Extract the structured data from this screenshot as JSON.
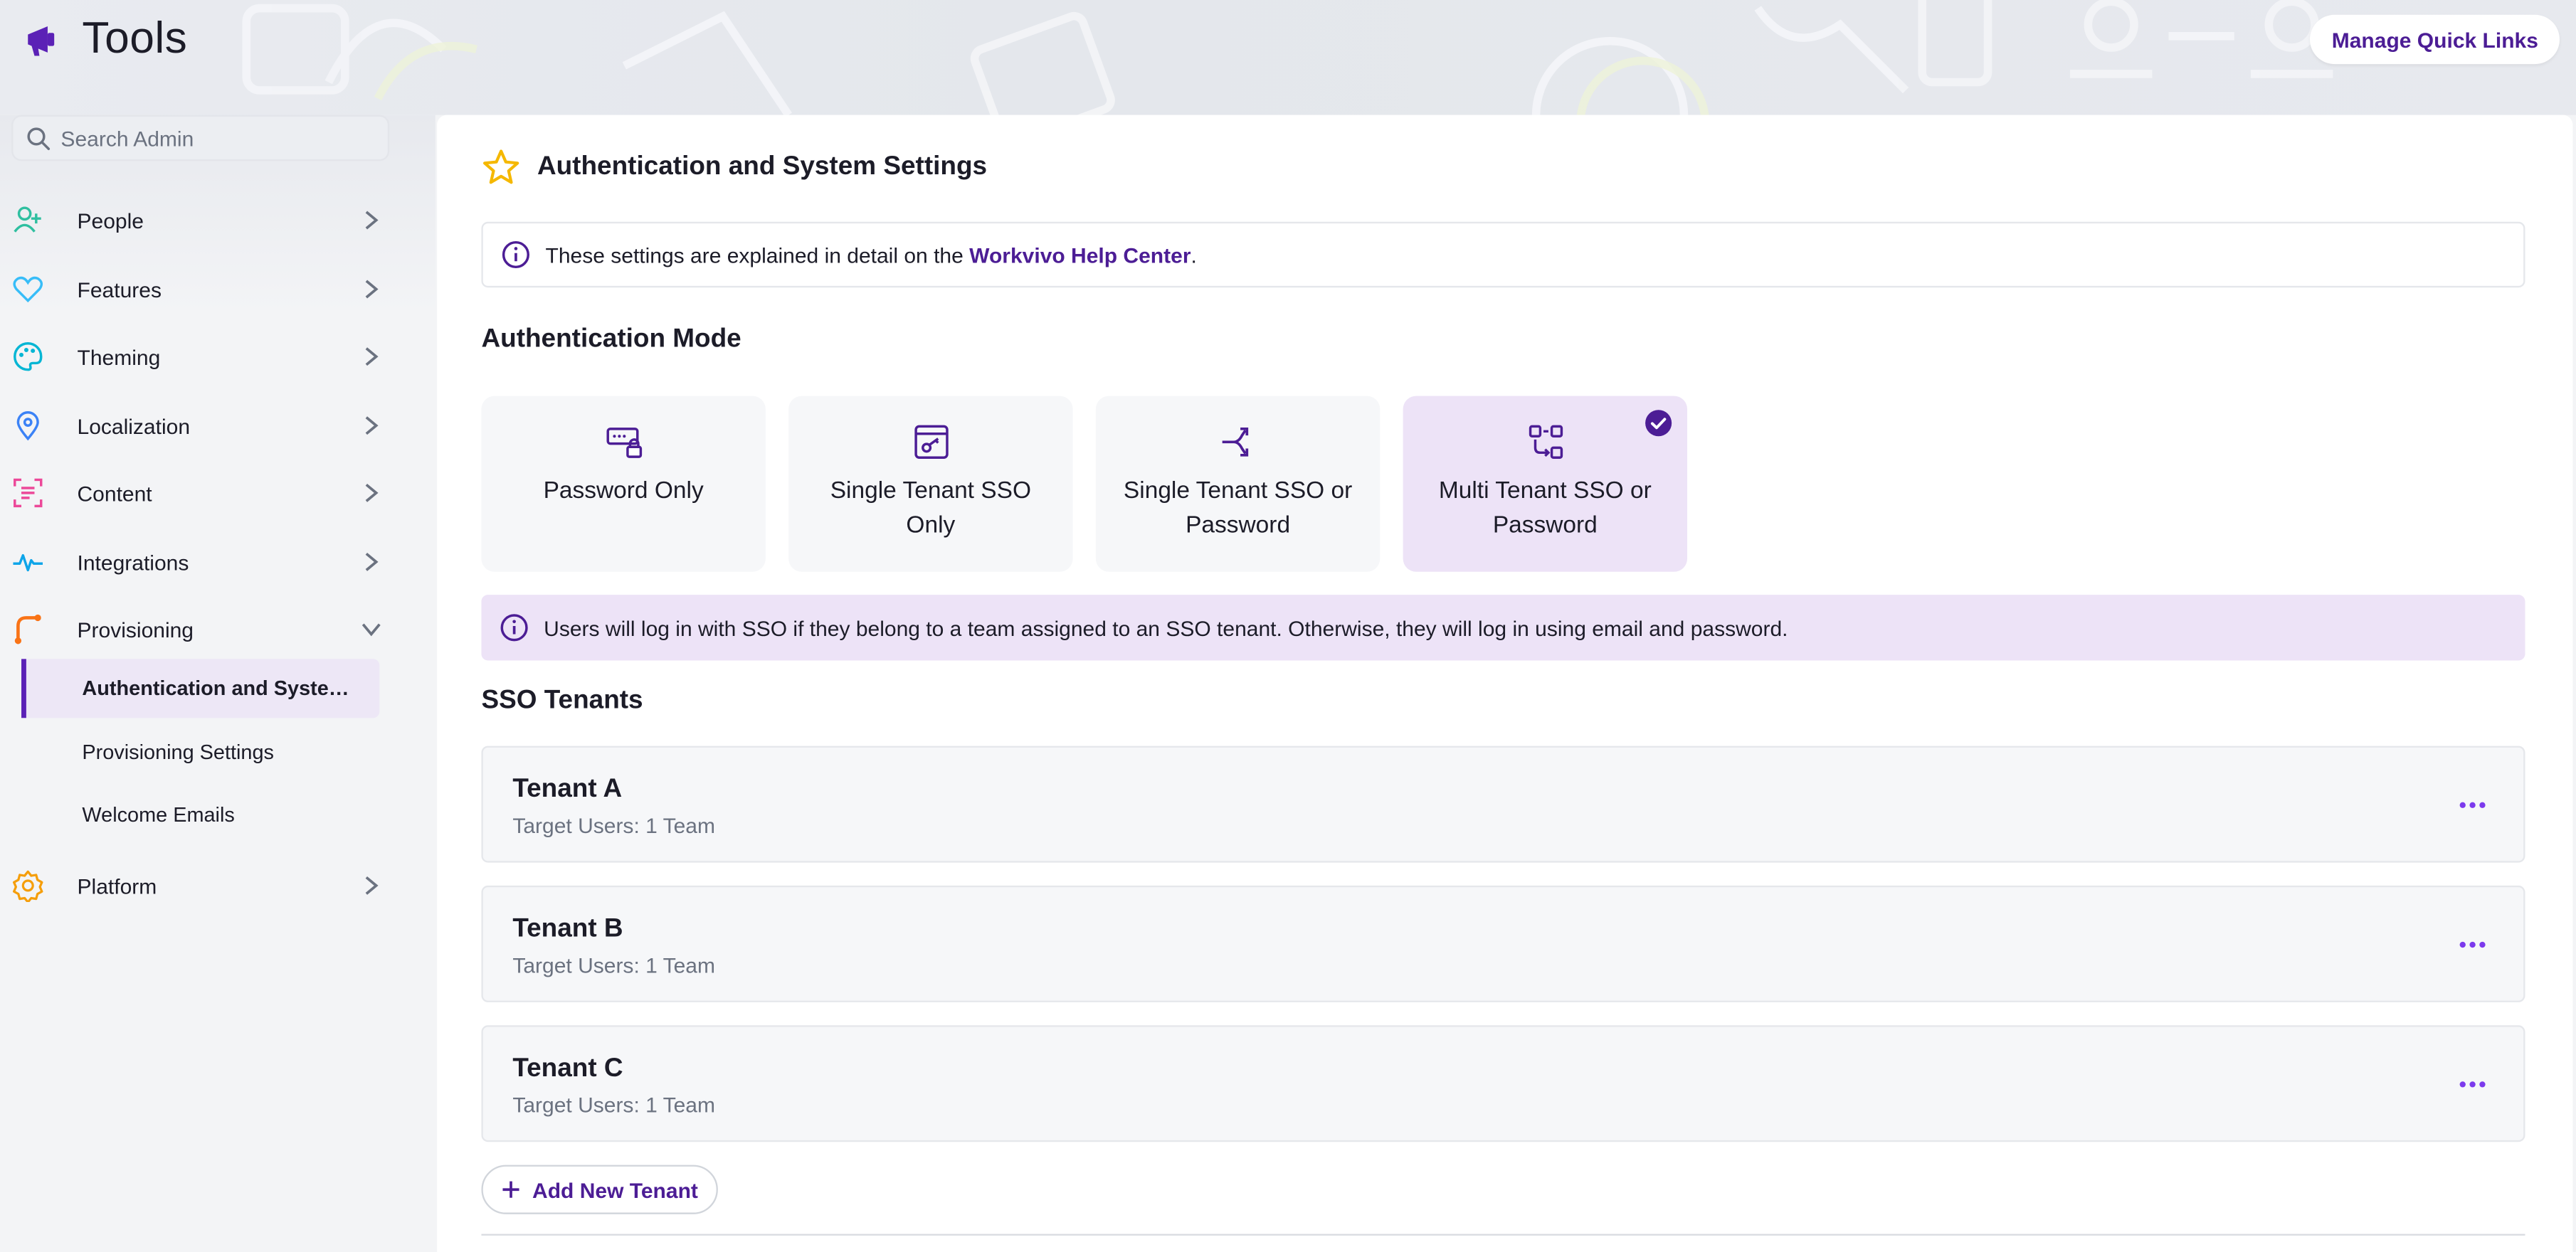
{
  "header": {
    "app_title": "Tools",
    "quick_links_label": "Manage Quick Links"
  },
  "sidebar": {
    "search_placeholder": "Search Admin",
    "items": [
      {
        "label": "People",
        "icon": "add-person-icon",
        "color": "#2fbfa0"
      },
      {
        "label": "Features",
        "icon": "heart-icon",
        "color": "#38bdf8"
      },
      {
        "label": "Theming",
        "icon": "palette-icon",
        "color": "#06b6d4"
      },
      {
        "label": "Localization",
        "icon": "map-pin-icon",
        "color": "#3b82f6"
      },
      {
        "label": "Content",
        "icon": "content-icon",
        "color": "#ec4899"
      },
      {
        "label": "Integrations",
        "icon": "pulse-icon",
        "color": "#0ea5e9"
      },
      {
        "label": "Provisioning",
        "icon": "provisioning-icon",
        "color": "#f97316"
      },
      {
        "label": "Platform",
        "icon": "gear-icon",
        "color": "#f59e0b"
      }
    ],
    "sub_items": [
      {
        "label": "Authentication and System Settings",
        "active": true
      },
      {
        "label": "Provisioning Settings",
        "active": false
      },
      {
        "label": "Welcome Emails",
        "active": false
      }
    ]
  },
  "main": {
    "page_title": "Authentication and System Settings",
    "info_text_prefix": "These settings are explained in detail on the ",
    "info_link": "Workvivo Help Center",
    "info_text_suffix": ".",
    "auth_mode_title": "Authentication Mode",
    "modes": [
      {
        "label": "Password Only",
        "icon": "password-lock-icon",
        "selected": false
      },
      {
        "label": "Single Tenant SSO Only",
        "icon": "sso-key-icon",
        "selected": false
      },
      {
        "label": "Single Tenant SSO or Password",
        "icon": "split-arrow-icon",
        "selected": false
      },
      {
        "label": "Multi Tenant SSO or Password",
        "icon": "multi-tenant-icon",
        "selected": true
      }
    ],
    "mode_info": "Users will log in with SSO if they belong to a team assigned to an SSO tenant. Otherwise, they will log in using email and password.",
    "sso_tenants_title": "SSO Tenants",
    "tenants": [
      {
        "name": "Tenant A",
        "target": "Target Users: 1 Team"
      },
      {
        "name": "Tenant B",
        "target": "Target Users: 1 Team"
      },
      {
        "name": "Tenant C",
        "target": "Target Users: 1 Team"
      }
    ],
    "add_tenant_label": "Add New Tenant"
  },
  "colors": {
    "accent": "#4c1d95",
    "selected_bg": "#ede3f7",
    "star": "#f5b800"
  }
}
